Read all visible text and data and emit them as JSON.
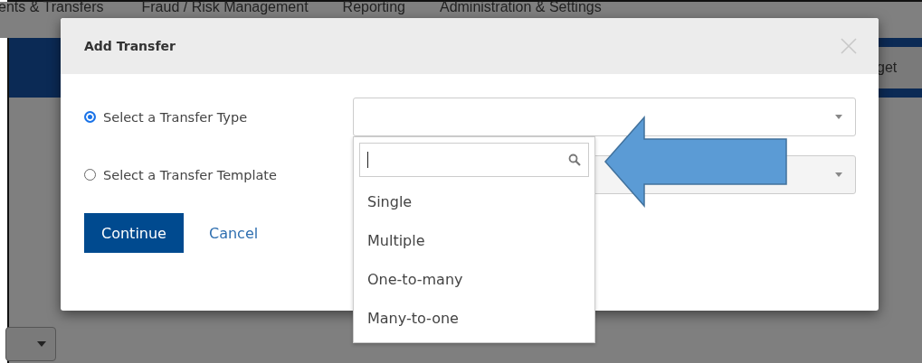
{
  "background": {
    "nav": [
      "ents & Transfers",
      "Fraud / Risk Management",
      "Reporting",
      "Administration & Settings"
    ],
    "button": "get"
  },
  "dialog": {
    "title": "Add Transfer",
    "options": [
      {
        "label": "Select a Transfer Type",
        "selected": true
      },
      {
        "label": "Select a Transfer Template",
        "selected": false
      }
    ],
    "dropdown": {
      "expanded": true,
      "items": [
        "Single",
        "Multiple",
        "One-to-many",
        "Many-to-one"
      ]
    },
    "buttons": {
      "primary": "Continue",
      "secondary": "Cancel"
    }
  }
}
